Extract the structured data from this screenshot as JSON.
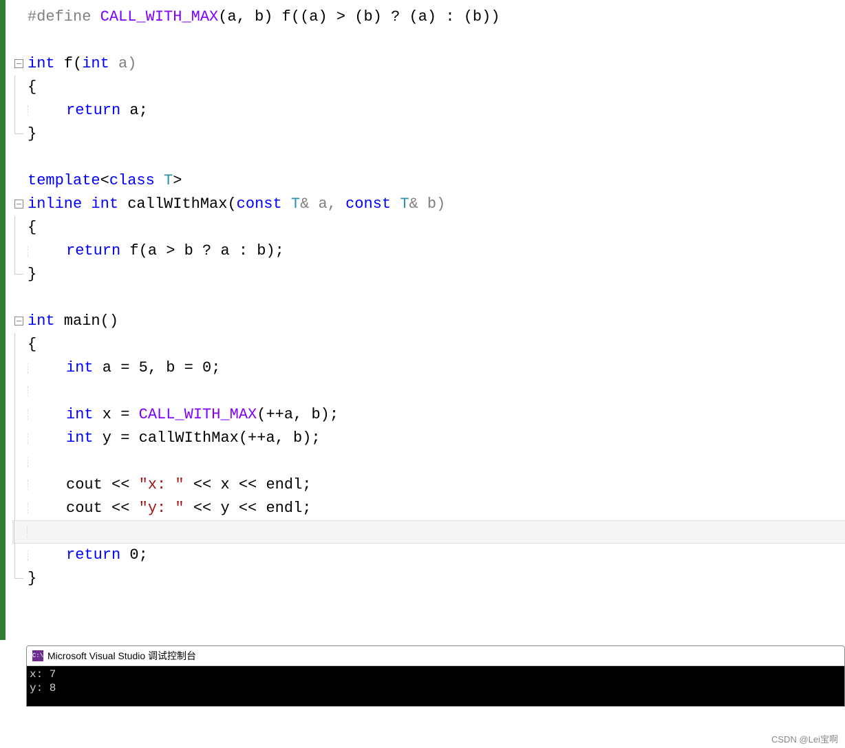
{
  "code": {
    "l1": {
      "pre": "#define",
      "macro": "CALL_WITH_MAX",
      "rest": "(a, b) f((a) > (b) ? (a) : (b))"
    },
    "l3": {
      "kw": "int",
      "fn": " f(",
      "kw2": "int",
      "rest": " a)"
    },
    "l4": "{",
    "l5": {
      "kw": "return",
      "rest": " a;"
    },
    "l6": "}",
    "l8": {
      "kw1": "template",
      "lt": "<",
      "kw2": "class",
      "sp": " ",
      "t": "T",
      "gt": ">"
    },
    "l9": {
      "kw1": "inline",
      "sp1": " ",
      "kw2": "int",
      "fn": " callWIthMax(",
      "kw3": "const",
      "sp2": " ",
      "t1": "T",
      "amp1": "& a, ",
      "kw4": "const",
      "sp3": " ",
      "t2": "T",
      "amp2": "& b)"
    },
    "l10": "{",
    "l11": {
      "kw": "return",
      "rest": " f(a > b ? a : b);"
    },
    "l12": "}",
    "l14": {
      "kw": "int",
      "fn": " main()"
    },
    "l15": "{",
    "l16": {
      "kw": "int",
      "rest": " a = 5, b = 0;"
    },
    "l18": {
      "kw": "int",
      "v": " x = ",
      "macro": "CALL_WITH_MAX",
      "rest": "(++a, b);"
    },
    "l19": {
      "kw": "int",
      "v": " y = callWIthMax(++a, b);"
    },
    "l21": {
      "p1": "cout << ",
      "s": "\"x: \"",
      "p2": " << x << endl;"
    },
    "l22": {
      "p1": "cout << ",
      "s": "\"y: \"",
      "p2": " << y << endl;"
    },
    "l24": {
      "kw": "return",
      "rest": " 0;"
    },
    "l25": "}"
  },
  "console": {
    "icon_text": "C:\\",
    "title": "Microsoft Visual Studio 调试控制台",
    "out1": "x: 7",
    "out2": "y: 8"
  },
  "watermark": "CSDN @Lei宝啊"
}
